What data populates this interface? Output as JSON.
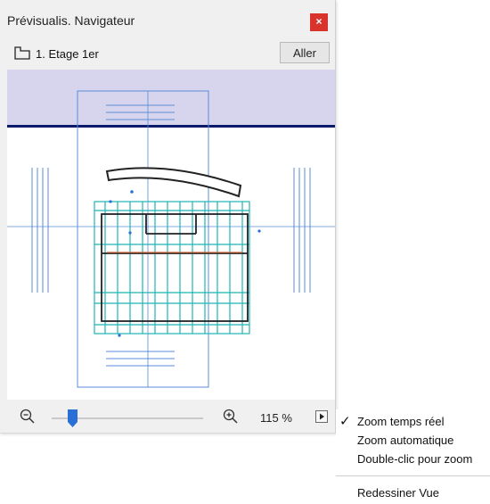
{
  "window": {
    "title": "Prévisualis. Navigateur",
    "close_label": "×"
  },
  "story": {
    "label": "1. Etage 1er",
    "go_label": "Aller"
  },
  "zoom": {
    "value_label": "115 %",
    "slider_level": 0.11
  },
  "menu": {
    "items": [
      {
        "label": "Zoom temps réel",
        "checked": true
      },
      {
        "label": "Zoom automatique",
        "checked": false
      },
      {
        "label": "Double-clic pour zoom",
        "checked": false
      },
      {
        "label": "Redessiner Vue",
        "checked": false
      }
    ],
    "check_glyph": "✓"
  },
  "colors": {
    "plan_accent": "#1fb5b5",
    "frame_blue": "#5a8bd8",
    "band": "#d6d5ed",
    "level_line": "#0b1a6b",
    "close_button": "#d9342b",
    "slider_thumb": "#2a6fd6"
  }
}
